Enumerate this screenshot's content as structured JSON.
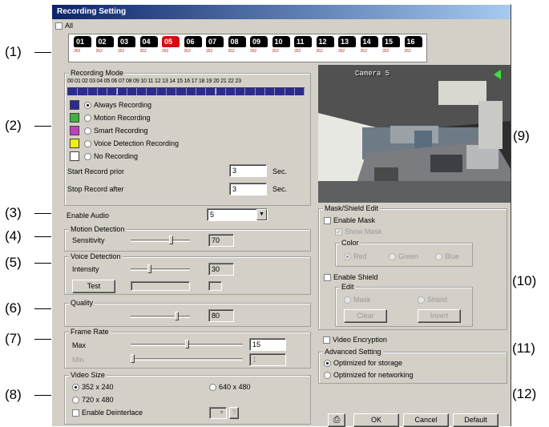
{
  "window_title": "Recording Setting",
  "all_checkbox_label": "All",
  "cameras": [
    {
      "num": "01",
      "res": "352"
    },
    {
      "num": "02",
      "res": "352"
    },
    {
      "num": "03",
      "res": "352"
    },
    {
      "num": "04",
      "res": "352"
    },
    {
      "num": "05",
      "res": "352",
      "selected": true
    },
    {
      "num": "06",
      "res": "352"
    },
    {
      "num": "07",
      "res": "352"
    },
    {
      "num": "08",
      "res": "352"
    },
    {
      "num": "09",
      "res": "352"
    },
    {
      "num": "10",
      "res": "352"
    },
    {
      "num": "11",
      "res": "352"
    },
    {
      "num": "12",
      "res": "352"
    },
    {
      "num": "13",
      "res": "352"
    },
    {
      "num": "14",
      "res": "352"
    },
    {
      "num": "15",
      "res": "352"
    },
    {
      "num": "16",
      "res": "352"
    }
  ],
  "callouts": [
    "(1)",
    "(2)",
    "(3)",
    "(4)",
    "(5)",
    "(6)",
    "(7)",
    "(8)",
    "(9)",
    "(10)",
    "(11)",
    "(12)"
  ],
  "recording_mode": {
    "title": "Recording Mode",
    "hours_label": "00 01 02 03 04 05 06 07 08 09 10 11 12 13 14 15 16 17 18 19 20 21 22 23",
    "modes": [
      {
        "label": "Always Recording",
        "color": "#2b2b90",
        "selected": true
      },
      {
        "label": "Motion Recording",
        "color": "#40b040"
      },
      {
        "label": "Smart Recording",
        "color": "#c040c0"
      },
      {
        "label": "Voice Detection Recording",
        "color": "#f0f000"
      },
      {
        "label": "No Recording",
        "color": "#ffffff"
      }
    ],
    "start_prior_label": "Start Record prior",
    "start_prior_value": "3",
    "stop_after_label": "Stop Record after",
    "stop_after_value": "3",
    "unit": "Sec."
  },
  "enable_audio": {
    "label": "Enable Audio",
    "value": "5"
  },
  "motion_detection": {
    "title": "Motion Detection",
    "sensitivity_label": "Sensitivity",
    "sensitivity_value": "70",
    "level": 0.7
  },
  "voice_detection": {
    "title": "Voice Detection",
    "intensity_label": "Intensity",
    "intensity_value": "30",
    "level": 0.3,
    "test_button": "Test"
  },
  "quality": {
    "title": "Quality",
    "value": "80",
    "level": 0.8
  },
  "frame_rate": {
    "title": "Frame Rate",
    "max_label": "Max",
    "max_value": "15",
    "max_level": 0.5,
    "min_label": "Min",
    "min_value": "1",
    "min_level": 0.0
  },
  "video_size": {
    "title": "Video Size",
    "options": [
      {
        "label": "352 x 240",
        "selected": true
      },
      {
        "label": "640 x 480"
      },
      {
        "label": "720 x 480"
      }
    ],
    "deinterlace_label": "Enable Deinterlace",
    "help_label": "?"
  },
  "preview": {
    "camera_label": "Camera 5"
  },
  "mask_shield": {
    "title": "Mask/Shield Edit",
    "enable_mask": "Enable Mask",
    "show_mask": "Show Mask",
    "color_title": "Color",
    "colors": [
      {
        "label": "Red",
        "selected": true
      },
      {
        "label": "Green"
      },
      {
        "label": "Blue"
      }
    ],
    "enable_shield": "Enable Shield",
    "edit_title": "Edit",
    "edit_options": [
      {
        "label": "Mask"
      },
      {
        "label": "Shield"
      }
    ],
    "clear_button": "Clear",
    "invert_button": "Invert"
  },
  "video_encryption_label": "Video Encryption",
  "advanced": {
    "title": "Advanced Setting",
    "options": [
      {
        "label": "Optimized for storage",
        "selected": true
      },
      {
        "label": "Optimized for networking"
      }
    ]
  },
  "buttons": {
    "ok": "OK",
    "cancel": "Cancel",
    "default": "Default"
  }
}
